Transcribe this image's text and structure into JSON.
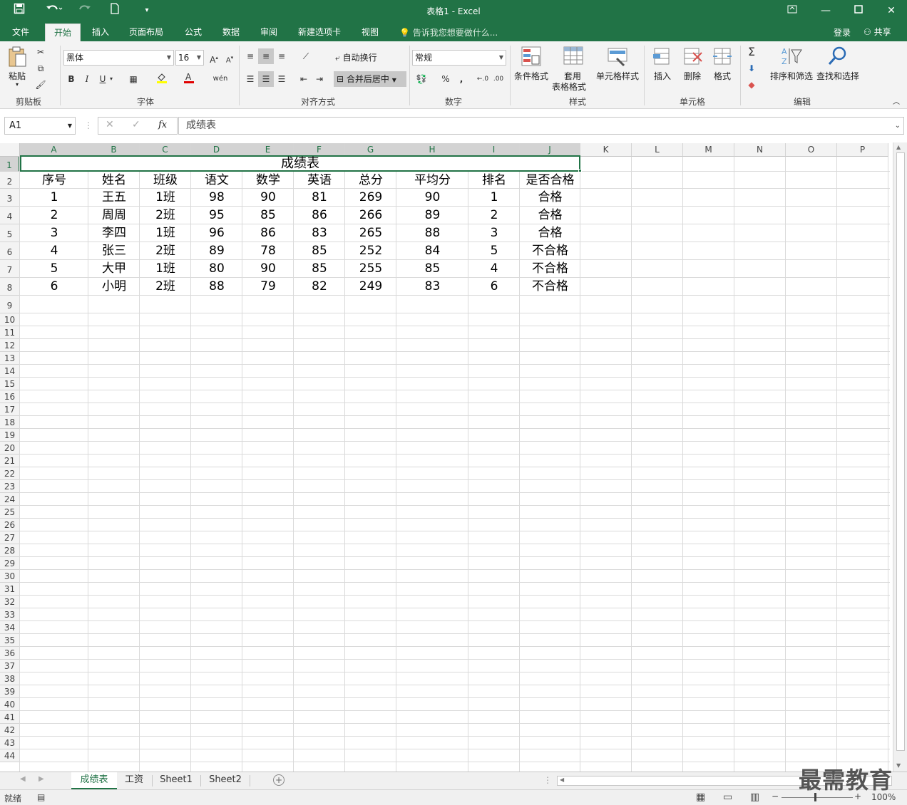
{
  "window": {
    "title": "表格1 - Excel"
  },
  "tabs": [
    {
      "label": "文件"
    },
    {
      "label": "开始"
    },
    {
      "label": "插入"
    },
    {
      "label": "页面布局"
    },
    {
      "label": "公式"
    },
    {
      "label": "数据"
    },
    {
      "label": "审阅"
    },
    {
      "label": "新建选项卡"
    },
    {
      "label": "视图"
    }
  ],
  "tell_me": "告诉我您想要做什么...",
  "account": {
    "login": "登录",
    "share": "共享"
  },
  "ribbon": {
    "clipboard": {
      "paste": "粘贴",
      "label": "剪贴板"
    },
    "font": {
      "name": "黑体",
      "size": "16",
      "label": "字体"
    },
    "alignment": {
      "wrap": "自动换行",
      "merge": "合并后居中",
      "label": "对齐方式"
    },
    "number": {
      "format": "常规",
      "label": "数字"
    },
    "styles": {
      "cond": "条件格式",
      "table_1": "套用",
      "table_2": "表格格式",
      "cell_styles": "单元格样式",
      "label": "样式"
    },
    "cells": {
      "insert": "插入",
      "delete": "删除",
      "format": "格式",
      "label": "单元格"
    },
    "editing": {
      "sort": "排序和筛选",
      "find": "查找和选择",
      "label": "编辑"
    }
  },
  "formula_bar": {
    "name_box": "A1",
    "fx": "fx",
    "formula": "成绩表"
  },
  "columns": [
    "A",
    "B",
    "C",
    "D",
    "E",
    "F",
    "G",
    "H",
    "I",
    "J",
    "K",
    "L",
    "M",
    "N",
    "O",
    "P"
  ],
  "rows": [
    "1",
    "2",
    "3",
    "4",
    "5",
    "6",
    "7",
    "8",
    "9",
    "10",
    "11",
    "12",
    "13",
    "14",
    "15",
    "16",
    "17",
    "18",
    "19",
    "20",
    "21",
    "22",
    "23",
    "24",
    "25",
    "26",
    "27",
    "28",
    "29",
    "30",
    "31",
    "32",
    "33",
    "34",
    "35",
    "36",
    "37",
    "38",
    "39",
    "40",
    "41",
    "42",
    "43",
    "44"
  ],
  "sheet": {
    "title": "成绩表",
    "headers": [
      "序号",
      "姓名",
      "班级",
      "语文",
      "数学",
      "英语",
      "总分",
      "平均分",
      "排名",
      "是否合格"
    ],
    "data": [
      [
        "1",
        "王五",
        "1班",
        "98",
        "90",
        "81",
        "269",
        "90",
        "1",
        "合格"
      ],
      [
        "2",
        "周周",
        "2班",
        "95",
        "85",
        "86",
        "266",
        "89",
        "2",
        "合格"
      ],
      [
        "3",
        "李四",
        "1班",
        "96",
        "86",
        "83",
        "265",
        "88",
        "3",
        "合格"
      ],
      [
        "4",
        "张三",
        "2班",
        "89",
        "78",
        "85",
        "252",
        "84",
        "5",
        "不合格"
      ],
      [
        "5",
        "大甲",
        "1班",
        "80",
        "90",
        "85",
        "255",
        "85",
        "4",
        "不合格"
      ],
      [
        "6",
        "小明",
        "2班",
        "88",
        "79",
        "82",
        "249",
        "83",
        "6",
        "不合格"
      ]
    ]
  },
  "sheet_tabs": [
    {
      "label": "成绩表"
    },
    {
      "label": "工资"
    },
    {
      "label": "Sheet1"
    },
    {
      "label": "Sheet2"
    }
  ],
  "status": {
    "ready": "就绪",
    "zoom": "100%"
  },
  "watermark": "最需教育",
  "colors": {
    "accent": "#217346"
  }
}
